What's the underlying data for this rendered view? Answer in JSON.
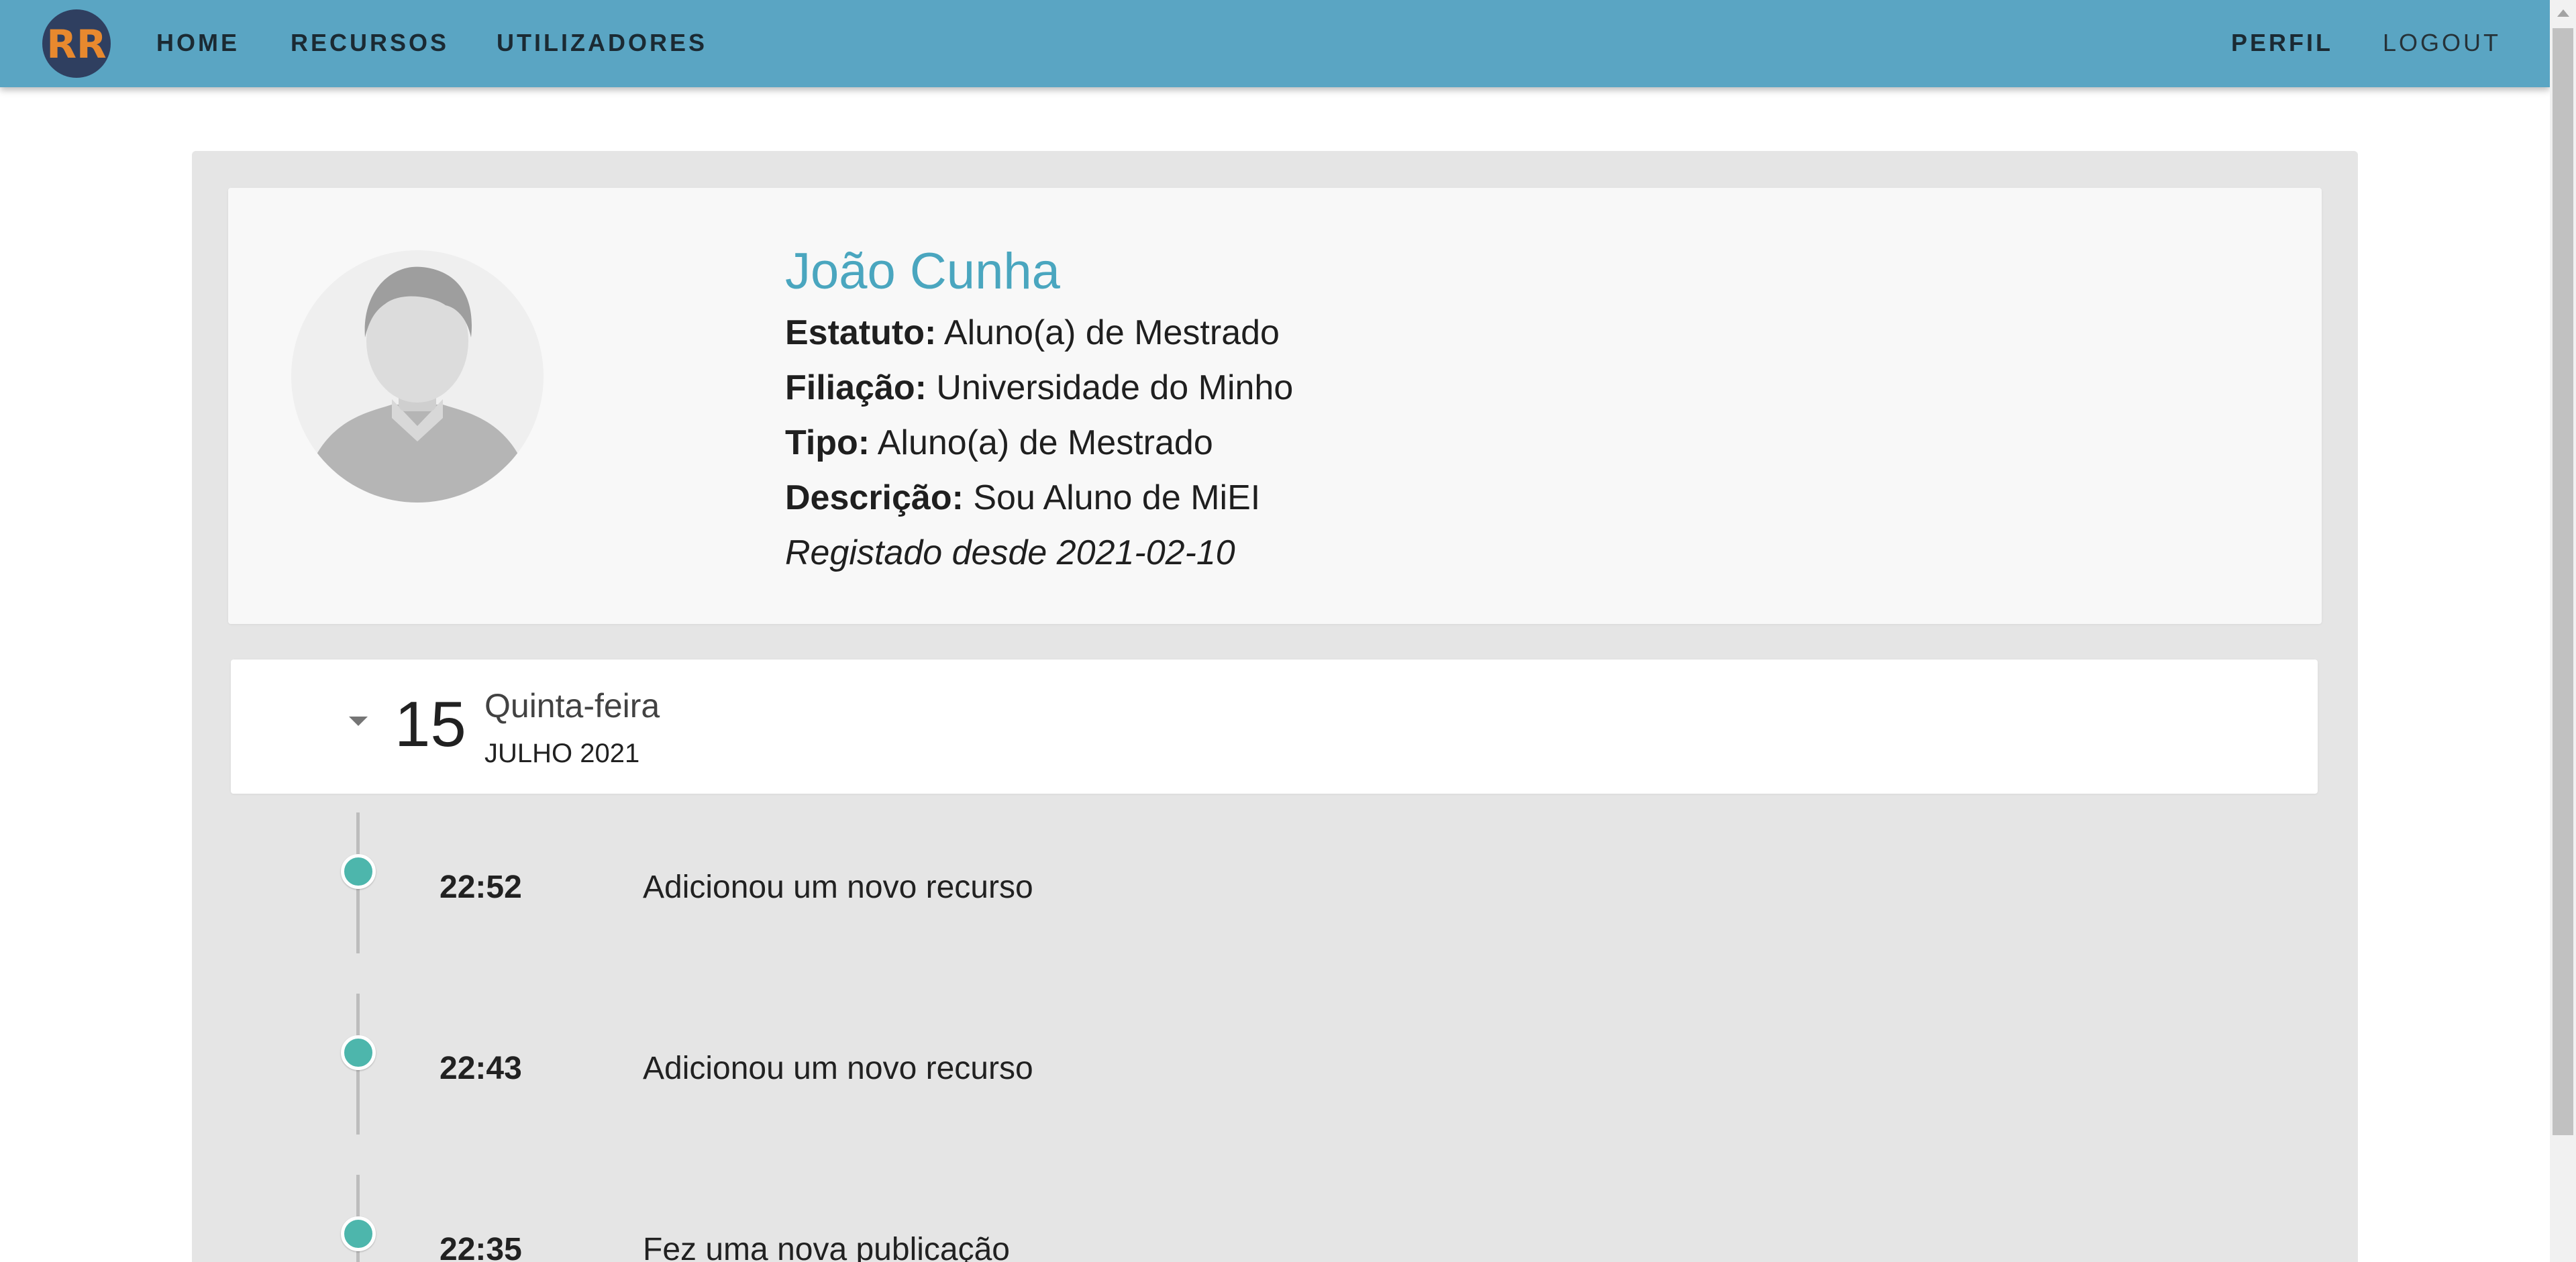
{
  "nav": {
    "logo_text": "RR",
    "links": [
      "HOME",
      "RECURSOS",
      "UTILIZADORES"
    ],
    "right_links": [
      "PERFIL",
      "LOGOUT"
    ]
  },
  "profile": {
    "name": "João Cunha",
    "fields": [
      {
        "label": "Estatuto:",
        "value": "Aluno(a) de Mestrado"
      },
      {
        "label": "Filiação:",
        "value": "Universidade do Minho"
      },
      {
        "label": "Tipo:",
        "value": "Aluno(a) de Mestrado"
      },
      {
        "label": "Descrição:",
        "value": "Sou Aluno de MiEI"
      }
    ],
    "registered": "Registado desde 2021-02-10"
  },
  "timeline": {
    "date": {
      "day": "15",
      "weekday": "Quinta-feira",
      "month_year": "JULHO 2021"
    },
    "events": [
      {
        "time": "22:52",
        "text": "Adicionou um novo recurso"
      },
      {
        "time": "22:43",
        "text": "Adicionou um novo recurso"
      },
      {
        "time": "22:35",
        "text": "Fez uma nova publicação"
      }
    ]
  },
  "colors": {
    "navbar": "#5aa5c3",
    "accent": "#4aa6bf",
    "timeline_dot": "#4db6ac",
    "logo_bg": "#2f3f60",
    "logo_fg": "#e8892e"
  }
}
